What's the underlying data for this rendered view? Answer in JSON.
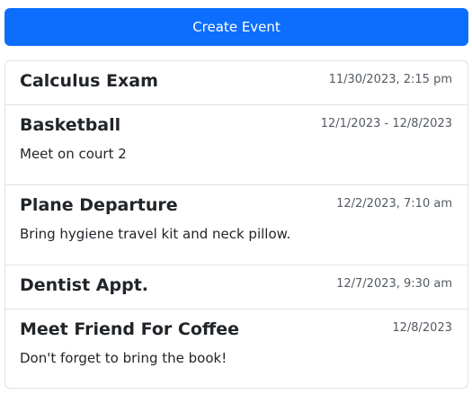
{
  "toolbar": {
    "create_label": "Create Event"
  },
  "events": [
    {
      "title": "Calculus Exam",
      "date": "11/30/2023, 2:15 pm",
      "description": ""
    },
    {
      "title": "Basketball",
      "date": "12/1/2023 - 12/8/2023",
      "description": "Meet on court 2"
    },
    {
      "title": "Plane Departure",
      "date": "12/2/2023, 7:10 am",
      "description": "Bring hygiene travel kit and neck pillow."
    },
    {
      "title": "Dentist Appt.",
      "date": "12/7/2023, 9:30 am",
      "description": ""
    },
    {
      "title": "Meet Friend For Coffee",
      "date": "12/8/2023",
      "description": "Don't forget to bring the book!"
    }
  ],
  "colors": {
    "primary": "#0d6efd",
    "border": "#dee2e6",
    "text": "#212529",
    "muted": "#545b62"
  }
}
